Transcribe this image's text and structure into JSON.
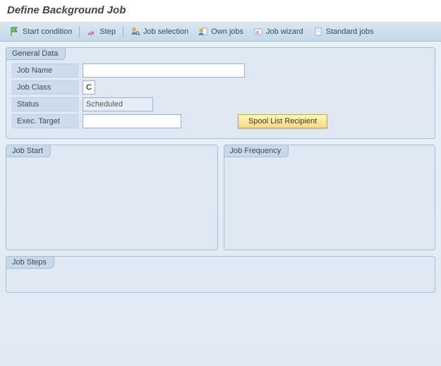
{
  "header": {
    "title": "Define Background Job"
  },
  "toolbar": {
    "start_condition": "Start condition",
    "step": "Step",
    "job_selection": "Job selection",
    "own_jobs": "Own jobs",
    "job_wizard": "Job wizard",
    "standard_jobs": "Standard jobs"
  },
  "panels": {
    "general_data": {
      "title": "General Data",
      "job_name_label": "Job Name",
      "job_name_value": "",
      "job_class_label": "Job Class",
      "job_class_value": "C",
      "status_label": "Status",
      "status_value": "Scheduled",
      "exec_target_label": "Exec. Target",
      "exec_target_value": "",
      "spool_button": "Spool List Recipient"
    },
    "job_start": {
      "title": "Job Start"
    },
    "job_frequency": {
      "title": "Job Frequency"
    },
    "job_steps": {
      "title": "Job Steps"
    }
  }
}
